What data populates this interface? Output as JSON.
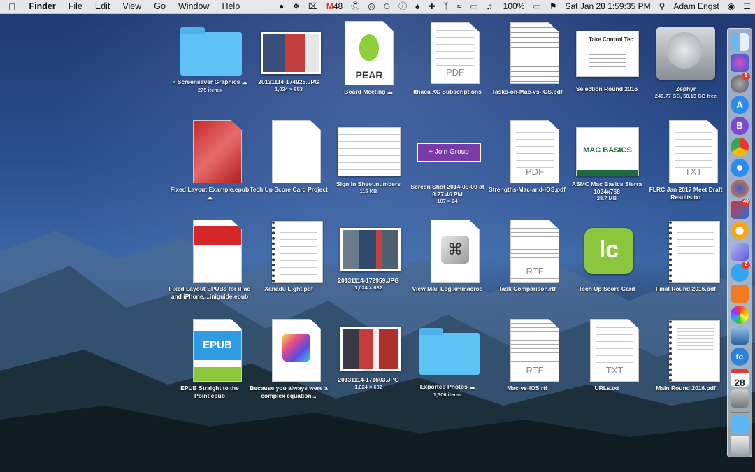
{
  "menubar": {
    "app_name": "Finder",
    "menus": [
      "File",
      "Edit",
      "View",
      "Go",
      "Window",
      "Help"
    ],
    "gmail_count": "48",
    "battery": "100%",
    "datetime": "Sat Jan 28  1:59:35 PM",
    "user": "Adam Engst"
  },
  "desktop": {
    "items": [
      {
        "label": "Screensaver Graphics",
        "sub": "275 items",
        "kind": "folder"
      },
      {
        "label": "20131114-174925.JPG",
        "sub": "1,024 × 653",
        "kind": "photo"
      },
      {
        "label": "Board Meeting",
        "sub": "",
        "kind": "pear",
        "art_text": "PEAR"
      },
      {
        "label": "Ithaca XC Subscriptions",
        "sub": "",
        "kind": "pdf",
        "art_text": "PDF"
      },
      {
        "label": "Tasks-on-Mac-vs-iOS.pdf",
        "sub": "",
        "kind": "table"
      },
      {
        "label": "Selection Round 2016",
        "sub": "",
        "kind": "slide",
        "art_text": "Take Control Tec"
      },
      {
        "label": "Zephyr",
        "sub": "249.77 GB, 58.13 GB free",
        "kind": "drive"
      },
      {
        "label": "Fixed Layout Example.epub",
        "sub": "",
        "kind": "epub-red"
      },
      {
        "label": "Tech Up Score Card Project",
        "sub": "",
        "kind": "blank"
      },
      {
        "label": "Sign In Sheet.numbers",
        "sub": "115 KB",
        "kind": "sheet"
      },
      {
        "label": "Screen Shot 2014-09-09 at 8.27.46 PM",
        "sub": "107 × 24",
        "kind": "button",
        "art_text": "+ Join Group"
      },
      {
        "label": "Strengths-Mac-and-iOS.pdf",
        "sub": "",
        "kind": "pdf",
        "art_text": "PDF"
      },
      {
        "label": "ASMC Mac Basics Sierra 1024x768",
        "sub": "28.7 MB",
        "kind": "macbasics",
        "art_text": "MAC BASICS"
      },
      {
        "label": "FLRC Jan 2017 Meet Draft Results.txt",
        "sub": "",
        "kind": "txt",
        "art_text": "TXT"
      },
      {
        "label": "Fixed Layout EPUBs for iPad and iPhone,...iniguide.epub",
        "sub": "",
        "kind": "epub-white"
      },
      {
        "label": "Xanadu Light.pdf",
        "sub": "",
        "kind": "notebook"
      },
      {
        "label": "20131114-172959.JPG",
        "sub": "1,024 × 682",
        "kind": "photo"
      },
      {
        "label": "View Mail Log.kmmacros",
        "sub": "",
        "kind": "kmmacros"
      },
      {
        "label": "Task Comparison.rtf",
        "sub": "",
        "kind": "rtf",
        "art_text": "RTF"
      },
      {
        "label": "Tech Up Score Card",
        "sub": "",
        "kind": "livecode",
        "art_text": "lc"
      },
      {
        "label": "Final Round 2016.pdf",
        "sub": "",
        "kind": "notebook2"
      },
      {
        "label": "EPUB Straight to the Point.epub",
        "sub": "",
        "kind": "epub-blue",
        "art_text": "EPUB"
      },
      {
        "label": "Because you always were a complex equation...",
        "sub": "",
        "kind": "grapher"
      },
      {
        "label": "20131114-171603.JPG",
        "sub": "1,024 × 682",
        "kind": "photo"
      },
      {
        "label": "Exported Photos",
        "sub": "1,306 items",
        "kind": "folder"
      },
      {
        "label": "Mac-vs-iOS.rtf",
        "sub": "",
        "kind": "rtf",
        "art_text": "RTF"
      },
      {
        "label": "URLs.txt",
        "sub": "",
        "kind": "txt",
        "art_text": "TXT"
      },
      {
        "label": "Main Round 2016.pdf",
        "sub": "",
        "kind": "notebook2"
      }
    ]
  },
  "dock": {
    "badges": [
      "1",
      "40",
      "2"
    ],
    "calendar_day": "28"
  },
  "colors": {
    "folder_blue": "#5ec3f4",
    "menubar_bg": "#ececec",
    "livecode_green": "#8cc63f"
  }
}
